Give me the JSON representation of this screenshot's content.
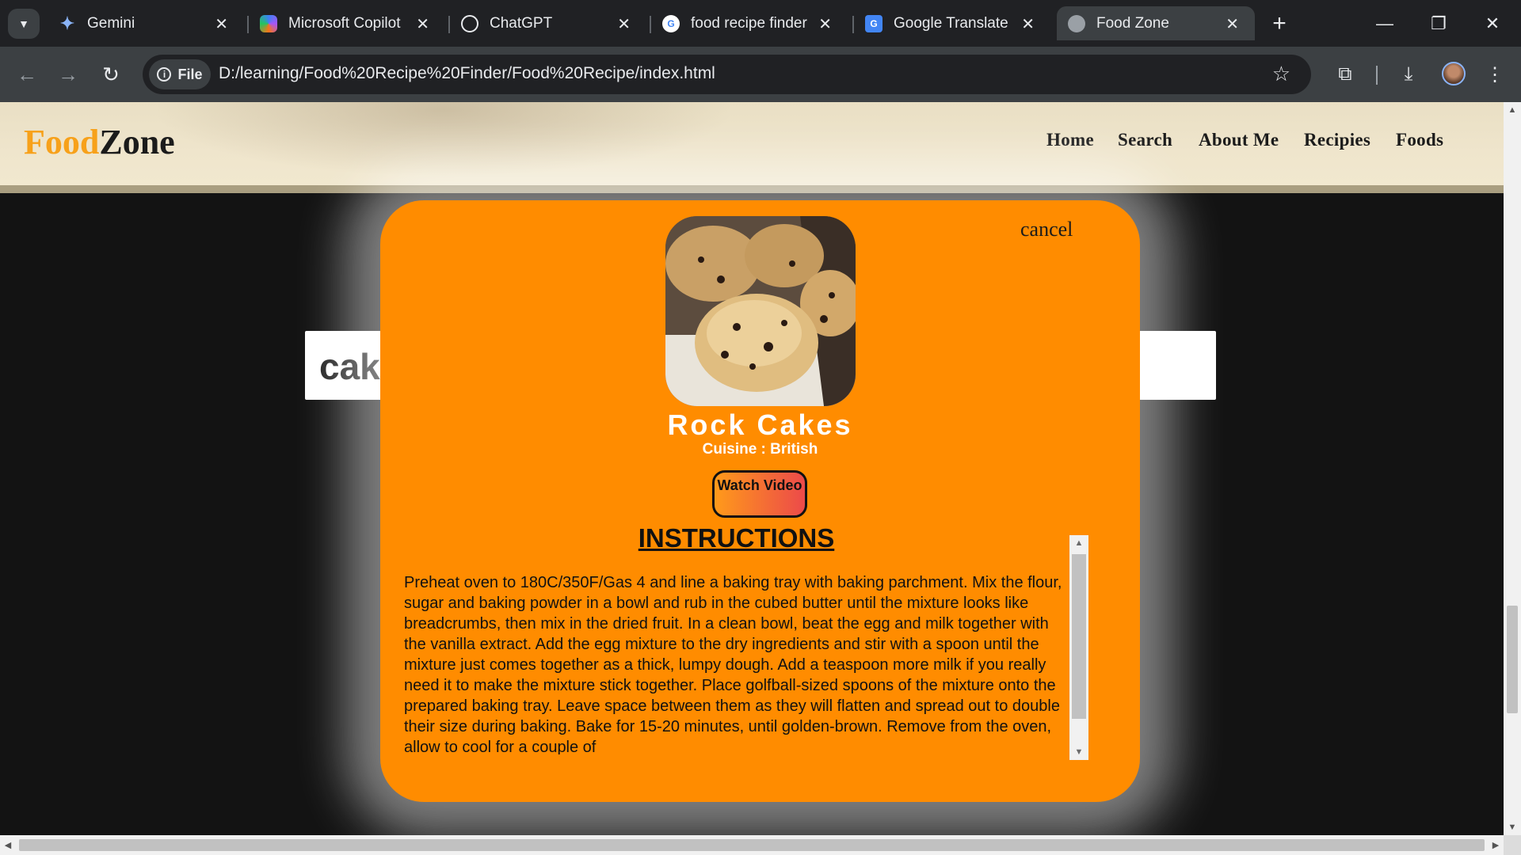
{
  "browser": {
    "tabs": [
      {
        "title": "Gemini",
        "icon": "gemini-icon",
        "active": false
      },
      {
        "title": "Microsoft Copilot",
        "icon": "copilot-icon",
        "active": false
      },
      {
        "title": "ChatGPT",
        "icon": "chatgpt-icon",
        "active": false
      },
      {
        "title": "food recipe finder",
        "icon": "google-icon",
        "active": false
      },
      {
        "title": "Google Translate",
        "icon": "translate-icon",
        "active": false
      },
      {
        "title": "Food Zone",
        "icon": "globe-icon",
        "active": true
      }
    ],
    "site_chip": "File",
    "url": "D:/learning/Food%20Recipe%20Finder/Food%20Recipe/index.html"
  },
  "site": {
    "logo_part1": "Food",
    "logo_part2": "Zone",
    "nav": [
      "Home",
      "Search",
      "About Me",
      "Recipies",
      "Foods"
    ],
    "search_value": "cake"
  },
  "modal": {
    "cancel_label": "cancel",
    "recipe_name": "Rock Cakes",
    "cuisine": "Cuisine : British",
    "watch_video_label": "Watch Video",
    "instructions_title": "INSTRUCTIONS",
    "instructions_text": "Preheat oven to 180C/350F/Gas 4 and line a baking tray with baking parchment. Mix the flour, sugar and baking powder in a bowl and rub in the cubed butter until the mixture looks like breadcrumbs, then mix in the dried fruit. In a clean bowl, beat the egg and milk together with the vanilla extract. Add the egg mixture to the dry ingredients and stir with a spoon until the mixture just comes together as a thick, lumpy dough. Add a teaspoon more milk if you really need it to make the mixture stick together. Place golfball-sized spoons of the mixture onto the prepared baking tray. Leave space between them as they will flatten and spread out to double their size during baking. Bake for 15-20 minutes, until golden-brown. Remove from the oven, allow to cool for a couple of"
  },
  "colors": {
    "modal_bg": "#ff8c00",
    "logo_accent": "#f7a11a",
    "browser_frame": "#202124"
  }
}
